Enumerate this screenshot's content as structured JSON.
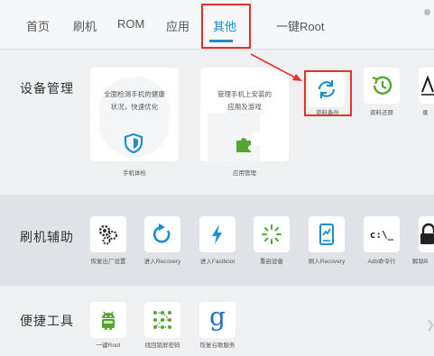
{
  "nav": {
    "tabs": [
      "首页",
      "刷机",
      "ROM",
      "应用",
      "其他",
      "一键Root"
    ],
    "active_index": 4
  },
  "device_management": {
    "title": "设备管理",
    "cards": [
      {
        "description_line1": "全面检测手机的健康",
        "description_line2": "状况，快速优化",
        "caption": "手机体检",
        "icon": "shield-icon"
      },
      {
        "description_line1": "管理手机上安装的",
        "description_line2": "应用及游戏",
        "caption": "应用管理",
        "icon": "puzzle-icon"
      }
    ],
    "tiles": [
      {
        "label": "资料备份",
        "icon": "sync-icon"
      },
      {
        "label": "资料还原",
        "icon": "history-icon"
      },
      {
        "label": "录",
        "icon": "partial-icon"
      }
    ]
  },
  "flash_assist": {
    "title": "刷机辅助",
    "tiles": [
      {
        "label": "恢复出厂设置",
        "icon": "gears-icon"
      },
      {
        "label": "进入Recovery",
        "icon": "refresh-arrow-icon"
      },
      {
        "label": "进入Fastboot",
        "icon": "lightning-icon"
      },
      {
        "label": "重启设备",
        "icon": "loading-spinner-icon"
      },
      {
        "label": "刷入Recovery",
        "icon": "phone-icon"
      },
      {
        "label": "Adb命令行",
        "icon": "terminal-icon",
        "glyph": "c:\\_"
      },
      {
        "label": "解除B",
        "icon": "lock-icon"
      }
    ]
  },
  "tools": {
    "title": "便捷工具",
    "tiles": [
      {
        "label": "一键Root",
        "icon": "android-icon"
      },
      {
        "label": "找回锁屏密码",
        "icon": "pattern-lock-icon"
      },
      {
        "label": "恢复谷歌服务",
        "icon": "google-icon",
        "glyph": "g"
      }
    ]
  },
  "colors": {
    "accent": "#1b8bd6",
    "highlight": "#e8302a",
    "green": "#55a630"
  }
}
